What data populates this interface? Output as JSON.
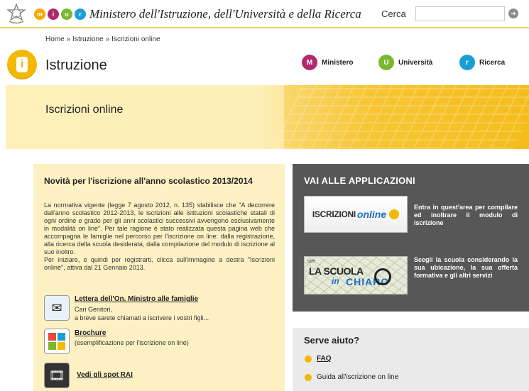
{
  "header": {
    "miur_letters": [
      "m",
      "i",
      "u",
      "r"
    ],
    "miur_colors": [
      "#f5a800",
      "#b0296b",
      "#7cb82f",
      "#1a9fd4"
    ],
    "ministry_name": "Ministero dell'Istruzione, dell'Università e della Ricerca",
    "search_label": "Cerca",
    "search_value": "",
    "search_button_icon": "arrow-right-icon"
  },
  "breadcrumb": {
    "items": [
      "Home",
      "Istruzione",
      "Iscrizioni online"
    ],
    "separator": "»"
  },
  "section": {
    "icon_letter": "i",
    "title": "Istruzione",
    "nav": [
      {
        "label": "Ministero",
        "letter": "M",
        "color": "#b0296b"
      },
      {
        "label": "Università",
        "letter": "U",
        "color": "#7cb82f"
      },
      {
        "label": "Ricerca",
        "letter": "r",
        "color": "#1a9fd4"
      }
    ]
  },
  "banner": {
    "title": "Iscrizioni online"
  },
  "news": {
    "title": "Novità per l'iscrizione all'anno scolastico 2013/2014",
    "paragraph1": "La normativa vigente (legge 7 agosto 2012, n. 135) stabilisce che \"A decorrere dall'anno scolastico 2012-2013, le iscrizioni alle istituzioni scolastiche statali di ogni ordine e grado per gli anni scolastici successivi avvengono esclusivamente in modalità on line\". Per tale ragione è stato realizzata questa pagina web che accompagna le famiglie nel percorso per l'iscrizione on line: dalla registrazione, alla ricerca della scuola desiderata, dalla compilazione del modulo di iscrizione al suo inoltro.",
    "paragraph2": "Per iniziare, e quindi per registrarti, clicca sull'immagine a destra \"Iscrizioni online\", attiva dal 21 Gennaio 2013."
  },
  "resources": [
    {
      "link": "Lettera dell'On. Ministro alle famiglie",
      "line1": "Cari Genitori,",
      "line2": "a breve sarete chiamati a iscrivere i vostri figli...",
      "icon": "letter-icon"
    },
    {
      "link": "Brochure",
      "line1": "(esemplificazione per l'iscrizione on line)",
      "line2": "",
      "icon": "brochure-icon"
    },
    {
      "link": "Vedi gli spot RAI",
      "line1": "",
      "line2": "",
      "icon": "film-icon"
    }
  ],
  "apps": {
    "title": "VAI ALLE APPLICAZIONI",
    "items": [
      {
        "thumb_a": "ISCRIZIONI",
        "thumb_b": "online",
        "description": "Entra in quest'area per compilare ed inoltrare il modulo di iscrizione"
      },
      {
        "thumb_small": "tale",
        "thumb_a": "LA SCUOLA",
        "thumb_in": "in",
        "thumb_b": "CHIARO",
        "description": "Scegli la scuola considerando la sua ubicazione, la sua offerta formativa e gli altri servizi"
      }
    ]
  },
  "help": {
    "title": "Serve aiuto?",
    "items": [
      "FAQ",
      "Guida all'iscrizione on line"
    ]
  }
}
